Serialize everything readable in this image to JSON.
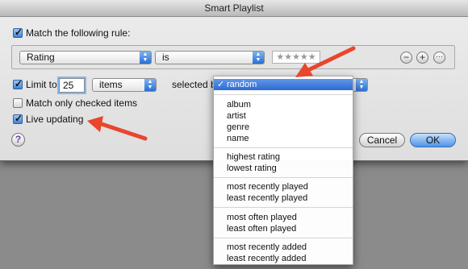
{
  "window": {
    "title": "Smart Playlist"
  },
  "rule_header": {
    "label": "Match the following rule:",
    "checked": true
  },
  "rule": {
    "field": "Rating",
    "operator": "is",
    "stars": "★★★★★",
    "remove_label": "−",
    "add_label": "+",
    "more_label": "···"
  },
  "limit": {
    "label": "Limit to",
    "checked": true,
    "value": "25",
    "unit": "items",
    "selected_by_label": "selected b"
  },
  "match_checked": {
    "label": "Match only checked items",
    "checked": false
  },
  "live_updating": {
    "label": "Live updating",
    "checked": true
  },
  "buttons": {
    "cancel": "Cancel",
    "ok": "OK",
    "help": "?"
  },
  "menu": {
    "items": [
      {
        "label": "random",
        "selected": true
      },
      {
        "label": "album"
      },
      {
        "label": "artist"
      },
      {
        "label": "genre"
      },
      {
        "label": "name"
      },
      {
        "label": "highest rating"
      },
      {
        "label": "lowest rating"
      },
      {
        "label": "most recently played"
      },
      {
        "label": "least recently played"
      },
      {
        "label": "most often played"
      },
      {
        "label": "least often played"
      },
      {
        "label": "most recently added"
      },
      {
        "label": "least recently added"
      }
    ],
    "check_mark": "✓"
  },
  "colors": {
    "annotation_arrow": "#e8462d",
    "accent": "#3f83d7"
  }
}
